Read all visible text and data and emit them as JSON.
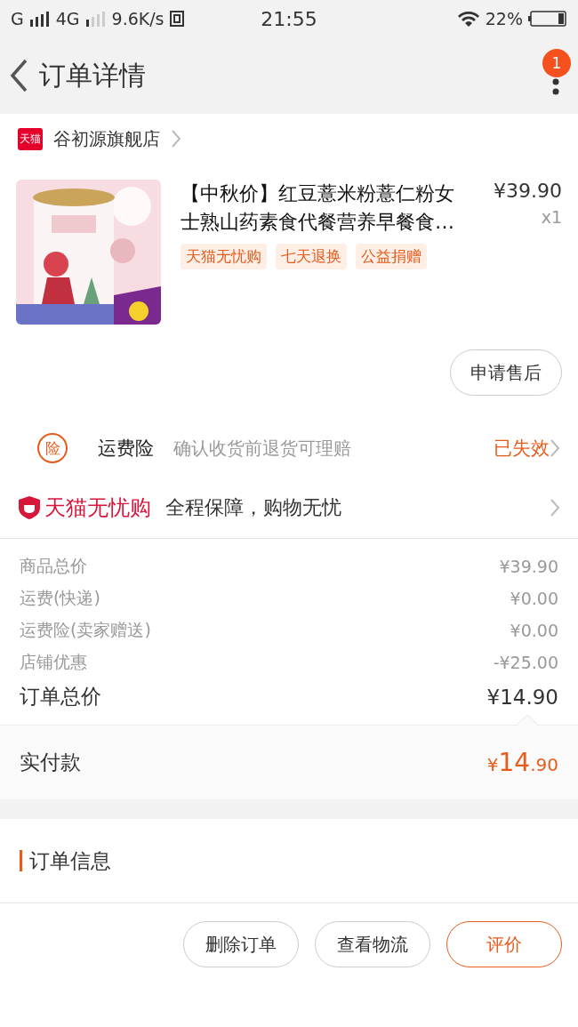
{
  "status_bar": {
    "carrier": "G",
    "network": "4G",
    "speed": "9.6K/s",
    "time": "21:55",
    "battery": "22%"
  },
  "nav": {
    "title": "订单详情",
    "badge": "1"
  },
  "store": {
    "logo": "天猫",
    "name": "谷初源旗舰店"
  },
  "product": {
    "kind": "picture",
    "title": "【中秋价】红豆薏米粉薏仁粉女士熟山药素食代餐营养早餐食…",
    "price": "¥39.90",
    "quantity": "x1",
    "tags": [
      "天猫无忧购",
      "七天退换",
      "公益捐赠"
    ],
    "after_sale_button": "申请售后"
  },
  "insurance": {
    "icon_char": "险",
    "name": "运费险",
    "description": "确认收货前退货可理赔",
    "status": "已失效"
  },
  "guarantee": {
    "brand": "天猫无忧购",
    "text": "全程保障，购物无忧"
  },
  "price_rows": [
    {
      "label": "商品总价",
      "value": "¥39.90",
      "kind": "normal"
    },
    {
      "label": "运费(快递)",
      "value": "¥0.00",
      "kind": "normal"
    },
    {
      "label": "运费险(卖家赠送)",
      "value": "¥0.00",
      "kind": "normal"
    },
    {
      "label": "店铺优惠",
      "value": "-¥25.00",
      "kind": "normal"
    },
    {
      "label": "订单总价",
      "value": "¥14.90",
      "kind": "total"
    }
  ],
  "paid": {
    "label": "实付款",
    "currency": "¥",
    "integer": "14",
    "decimals": ".90"
  },
  "order_info": {
    "title": "订单信息"
  },
  "buttons": [
    {
      "label": "删除订单",
      "kind": "default"
    },
    {
      "label": "查看物流",
      "kind": "default"
    },
    {
      "label": "评价",
      "kind": "primary"
    }
  ]
}
